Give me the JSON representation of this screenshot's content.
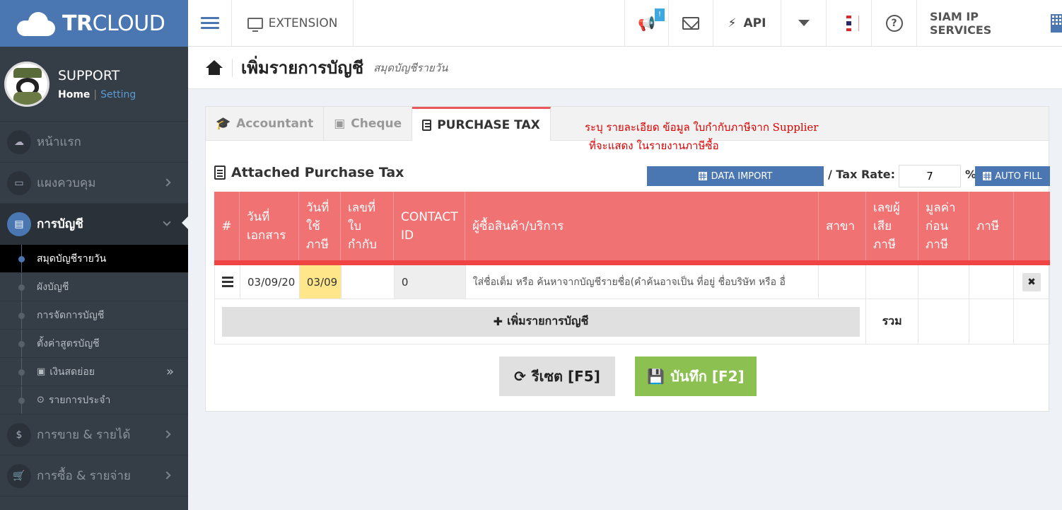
{
  "brand": {
    "name_bold": "TR",
    "name_light": "CLOUD"
  },
  "topbar": {
    "extension_label": "EXTENSION",
    "notification_count": "!",
    "api_label": "API",
    "company_label": "SIAM IP SERVICES"
  },
  "profile": {
    "name": "SUPPORT",
    "home_link": "Home",
    "separator": "|",
    "setting_link": "Setting"
  },
  "sidebar": {
    "items": [
      {
        "label": "หน้าแรก",
        "icon": "cloud-icon"
      },
      {
        "label": "แผงควบคุม",
        "icon": "monitor-icon"
      },
      {
        "label": "การบัญชี",
        "icon": "book-icon"
      }
    ],
    "sub_items": [
      {
        "label": "สมุดบัญชีรายวัน"
      },
      {
        "label": "ผังบัญชี"
      },
      {
        "label": "การจัดการบัญชี"
      },
      {
        "label": "ตั้งค่าสูตรบัญชี"
      },
      {
        "label": "เงินสดย่อย"
      },
      {
        "label": "รายการประจำ"
      }
    ],
    "bottom_items": [
      {
        "label": "การขาย & รายได้",
        "icon": "dollar-icon"
      },
      {
        "label": "การซื้อ & รายจ่าย",
        "icon": "cart-icon"
      }
    ]
  },
  "page": {
    "title": "เพิ่มรายการบัญชี",
    "subtitle": "สมุดบัญชีรายวัน"
  },
  "tabs": [
    {
      "label": "Accountant"
    },
    {
      "label": "Cheque"
    },
    {
      "label": "PURCHASE TAX"
    }
  ],
  "note": {
    "line1": "ระบุ รายละเอียด ข้อมูล ใบกำกับภาษีจาก Supplier",
    "line2": "ที่จะแสดง ในรายงานภาษีซื้อ"
  },
  "section": {
    "title": "Attached Purchase Tax",
    "import_button": "DATA IMPORT",
    "tax_rate_label": "/ Tax Rate:",
    "tax_rate_value": "7",
    "percent": "%",
    "autofill_button": "AUTO FILL"
  },
  "table": {
    "headers": [
      "#",
      "วันที่ เอกสาร",
      "วันที่ ใช้ ภาษี",
      "เลขที่ ใบ กำกับ",
      "CONTACT ID",
      "ผู้ซื้อสินค้า/บริการ",
      "สาขา",
      "เลขผู้ เสีย ภาษี",
      "มูลค่า ก่อน ภาษี",
      "ภาษี",
      ""
    ],
    "row": {
      "doc_date": "03/09/20",
      "tax_date": "03/09",
      "invoice_no": "",
      "contact_id": "0",
      "buyer_placeholder": "ใส่ชื่อเต็ม หรือ ค้นหาจากบัญชีรายชื่อ(คำค้นอาจเป็น ที่อยู่ ชื่อบริษัท หรือ อื่",
      "delete_label": "✖"
    },
    "add_button": "เพิ่มรายการบัญชี",
    "sum_label": "รวม"
  },
  "actions": {
    "reset_button": "รีเซต [F5]",
    "save_button": "บันทึก [F2]"
  },
  "colors": {
    "primary": "#4a77b2",
    "header_red": "#f17272",
    "save_green": "#8cc152",
    "sidebar": "#353d47"
  }
}
